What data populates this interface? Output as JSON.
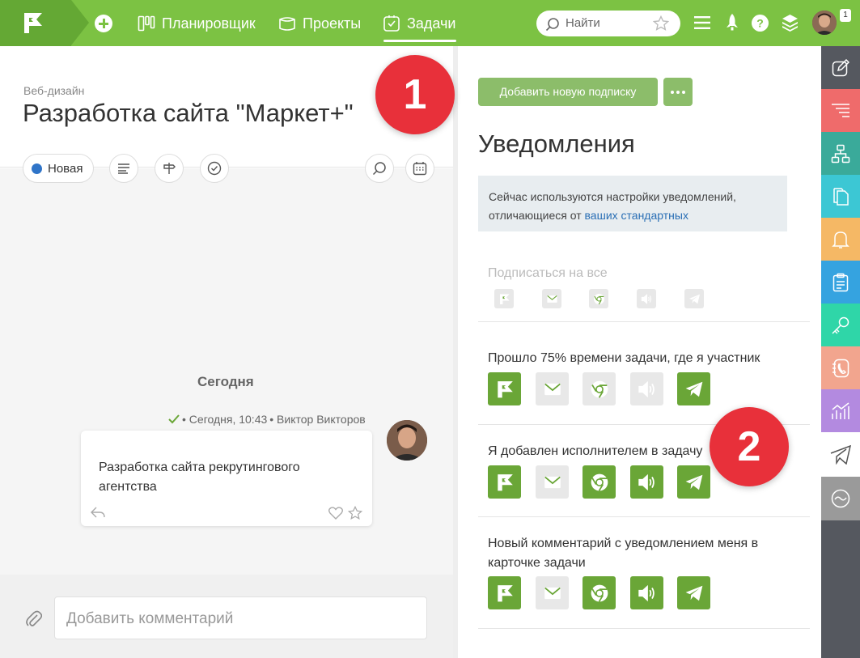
{
  "nav": {
    "items": [
      {
        "label": "Планировщик"
      },
      {
        "label": "Проекты"
      },
      {
        "label": "Задачи"
      }
    ],
    "search_placeholder": "Найти",
    "badge_count": "1"
  },
  "task": {
    "category": "Веб-дизайн",
    "title": "Разработка сайта \"Маркет+\"",
    "status": "Новая",
    "status_color": "#2f74c8"
  },
  "feed": {
    "day_label": "Сегодня",
    "meta_time": "• Сегодня, 10:43",
    "meta_author": "• Виктор Викторов",
    "comment_text": "Разработка сайта рекрутингового агентства",
    "input_placeholder": "Добавить комментарий"
  },
  "subscriptions": {
    "add_button": "Добавить новую подписку",
    "title": "Уведомления",
    "info_text": "Сейчас используются настройки уведомлений, отличающиеся от ",
    "info_link": "ваших стандартных",
    "rows": [
      {
        "label": "Подписаться на все"
      },
      {
        "label": "Прошло 75% времени задачи, где я участник",
        "channels": [
          true,
          false,
          false,
          false,
          true
        ]
      },
      {
        "label": "Я добавлен исполнителем в задачу",
        "channels": [
          true,
          false,
          true,
          true,
          true
        ]
      },
      {
        "label": "Новый комментарий с уведомлением меня в",
        "label2": "карточке задачи",
        "channels": [
          true,
          false,
          true,
          true,
          true
        ]
      }
    ],
    "channel_icons": [
      "flag-icon",
      "mail-icon",
      "chrome-icon",
      "sound-icon",
      "telegram-icon"
    ]
  },
  "markers": [
    "1",
    "2"
  ],
  "sidebar_colors": [
    "#55585f",
    "#ef6b6b",
    "#3aaa9a",
    "#3cc7d4",
    "#f5b865",
    "#35a3e0",
    "#2fd6a8",
    "#f2a58e",
    "#b38ae0",
    "#ffffff",
    "#9a9a9a"
  ],
  "colors": {
    "brand_green": "#7cc243",
    "channel_on": "#6aa637",
    "marker_red": "#e8303a"
  }
}
